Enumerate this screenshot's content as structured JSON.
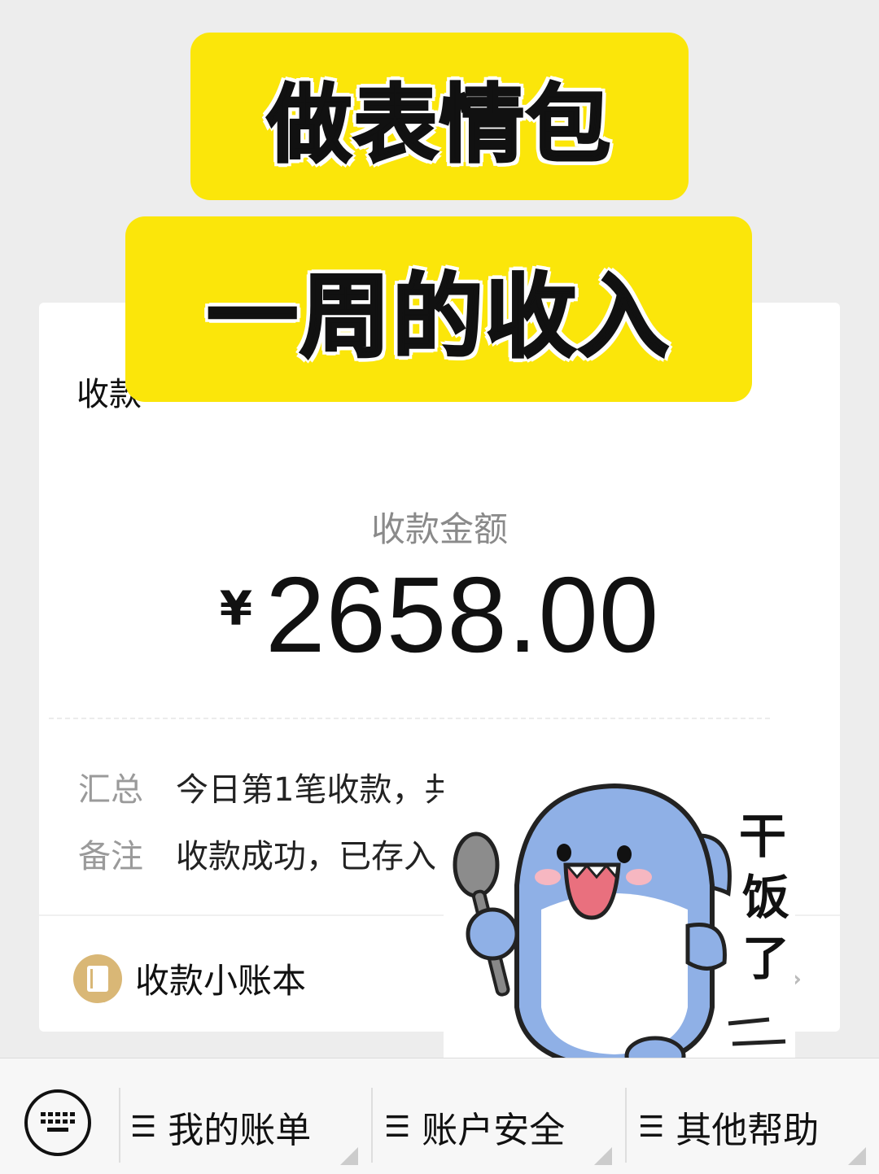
{
  "banners": {
    "line1": "做表情包",
    "line2": "一周的收入"
  },
  "receipt": {
    "title_fragment": "收款",
    "amount_label": "收款金额",
    "currency": "¥",
    "amount": "2658.00",
    "summary_label": "汇总",
    "summary_value": "今日第1笔收款，共",
    "note_label": "备注",
    "note_value": "收款成功，已存入",
    "ledger_label": "收款小账本",
    "ledger_icon": "ledger-book-icon",
    "chevron_icon": "chevron-right-icon"
  },
  "sticker": {
    "caption": "干饭了",
    "description_icon": "shark-with-spoon-sticker"
  },
  "bottom_menu": {
    "keyboard_icon": "keyboard-icon",
    "items": [
      {
        "label": "我的账单",
        "icon": "menu-icon"
      },
      {
        "label": "账户安全",
        "icon": "menu-icon"
      },
      {
        "label": "其他帮助",
        "icon": "menu-icon"
      }
    ]
  },
  "colors": {
    "banner_yellow": "#fbe60a",
    "background": "#ededed",
    "ledger_gold": "#d9b776",
    "shark_blue": "#8fb0e6"
  }
}
